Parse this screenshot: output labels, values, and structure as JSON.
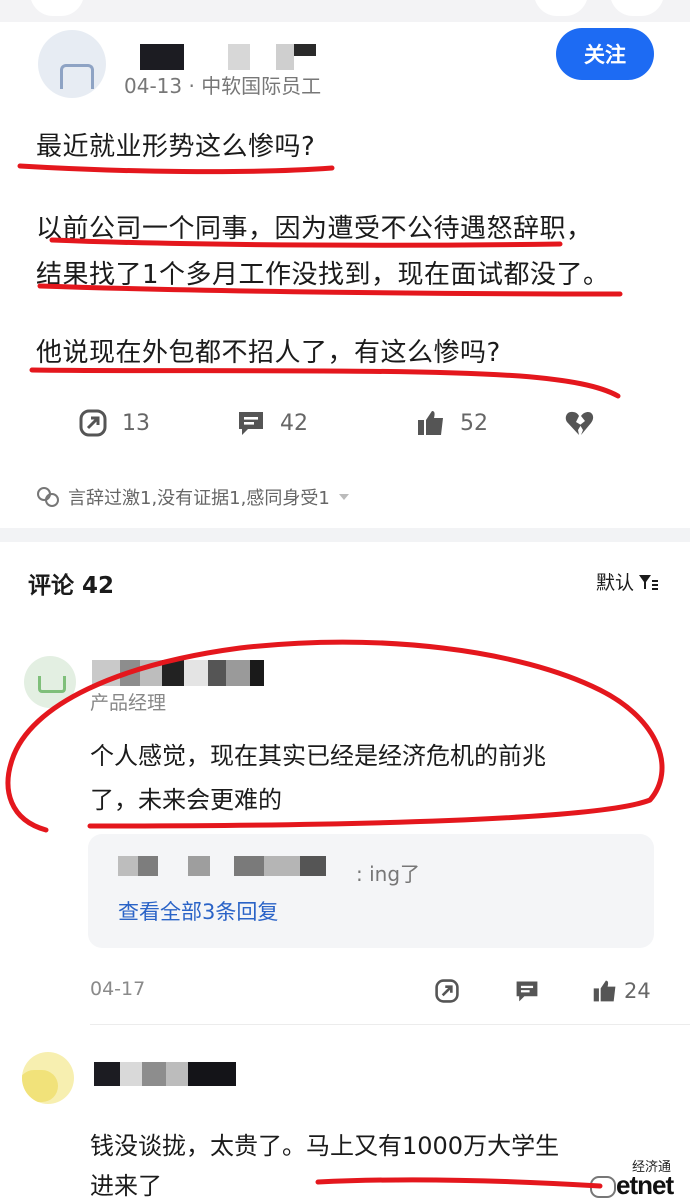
{
  "post": {
    "meta": "04-13 · 中软国际员工",
    "follow_label": "关注",
    "lines": [
      "最近就业形势这么惨吗?",
      "以前公司一个同事，因为遭受不公待遇怒辞职，",
      "结果找了1个多月工作没找到，现在面试都没了。",
      "他说现在外包都不招人了，有这么惨吗?"
    ],
    "actions": {
      "share_count": "13",
      "comment_count": "42",
      "like_count": "52"
    },
    "reaction_tags": "言辞过激1,没有证据1,感同身受1"
  },
  "comments": {
    "title": "评论 42",
    "sort_label": "默认",
    "items": [
      {
        "role": "产品经理",
        "lines": [
          "个人感觉，现在其实已经是经济危机的前兆",
          "了，未来会更难的"
        ],
        "reply_tail": ": ing了",
        "reply_more": "查看全部3条回复",
        "date": "04-17",
        "like_count": "24"
      },
      {
        "lines": [
          "钱没谈拢，太贵了。马上又有1000万大学生",
          "进来了"
        ]
      }
    ]
  },
  "watermark": {
    "top": "经济通",
    "brand": "etnet"
  },
  "colors": {
    "accent": "#1d6bf3",
    "annotation_red": "#e4171d"
  }
}
